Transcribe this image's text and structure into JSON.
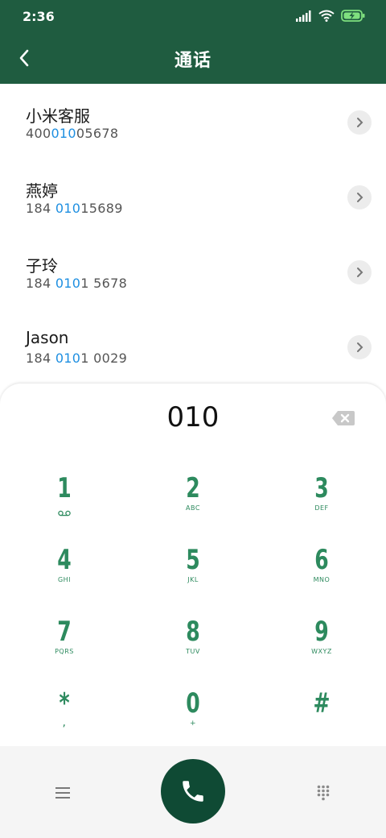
{
  "status_bar": {
    "time": "2:36",
    "icons": [
      "signal-icon",
      "wifi-icon",
      "battery-charging-icon"
    ]
  },
  "header": {
    "title": "通话",
    "back_icon": "back-arrow-icon"
  },
  "results": [
    {
      "name": "小米客服",
      "number_pre": "400",
      "number_match": "010",
      "number_post": "05678"
    },
    {
      "name": "燕婷",
      "number_pre": "184 ",
      "number_match": "010",
      "number_post": "15689"
    },
    {
      "name": "子玲",
      "number_pre": "184 ",
      "number_match": "010",
      "number_post": "1 5678"
    },
    {
      "name": "Jason",
      "number_pre": "184 ",
      "number_match": "010",
      "number_post": "1 0029"
    }
  ],
  "dialpad": {
    "input": "010",
    "keys": [
      {
        "digit": "1",
        "letters": ""
      },
      {
        "digit": "2",
        "letters": "ABC"
      },
      {
        "digit": "3",
        "letters": "DEF"
      },
      {
        "digit": "4",
        "letters": "GHI"
      },
      {
        "digit": "5",
        "letters": "JKL"
      },
      {
        "digit": "6",
        "letters": "MNO"
      },
      {
        "digit": "7",
        "letters": "PQRS"
      },
      {
        "digit": "8",
        "letters": "TUV"
      },
      {
        "digit": "9",
        "letters": "WXYZ"
      },
      {
        "digit": "*",
        "letters": ","
      },
      {
        "digit": "0",
        "letters": "+"
      },
      {
        "digit": "#",
        "letters": ""
      }
    ]
  },
  "colors": {
    "header": "#1f5c40",
    "accent": "#2d8a5e",
    "match": "#1e8fe1",
    "call_button": "#0f4a34"
  }
}
